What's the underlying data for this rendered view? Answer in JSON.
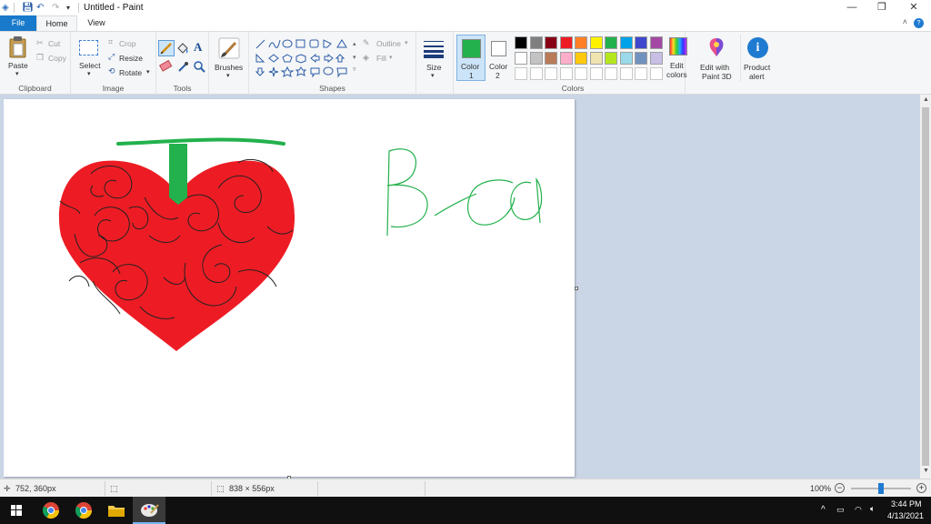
{
  "window": {
    "title": "Untitled - Paint",
    "minimize": "—",
    "restore": "❐",
    "close": "✕"
  },
  "tabs": {
    "file": "File",
    "home": "Home",
    "view": "View"
  },
  "ribbon": {
    "clipboard": {
      "label": "Clipboard",
      "paste": "Paste",
      "cut": "Cut",
      "copy": "Copy"
    },
    "image": {
      "label": "Image",
      "select": "Select",
      "crop": "Crop",
      "resize": "Resize",
      "rotate": "Rotate"
    },
    "tools": {
      "label": "Tools"
    },
    "brushes": {
      "label": "Brushes"
    },
    "shapes": {
      "label": "Shapes",
      "outline": "Outline",
      "fill": "Fill"
    },
    "size": {
      "label": "Size"
    },
    "colors": {
      "label": "Colors",
      "color1_label": "Color",
      "color1_num": "1",
      "color1_value": "#22b14c",
      "color2_label": "Color",
      "color2_num": "2",
      "color2_value": "#ffffff",
      "edit_colors_1": "Edit",
      "edit_colors_2": "colors",
      "palette_row1": [
        "#000000",
        "#7f7f7f",
        "#880015",
        "#ed1c24",
        "#ff7f27",
        "#fff200",
        "#22b14c",
        "#00a2e8",
        "#3f48cc",
        "#a349a4"
      ],
      "palette_row2": [
        "#ffffff",
        "#c3c3c3",
        "#b97a57",
        "#ffaec9",
        "#ffc90e",
        "#efe4b0",
        "#b5e61d",
        "#99d9ea",
        "#7092be",
        "#c8bfe7"
      ]
    },
    "paint3d": {
      "line1": "Edit with",
      "line2": "Paint 3D"
    },
    "product_alert": {
      "line1": "Product",
      "line2": "alert"
    }
  },
  "status": {
    "cursor_pos": "752, 360px",
    "canvas_size": "838 × 556px",
    "zoom": "100%",
    "zoom_level": 0.5
  },
  "taskbar": {
    "time": "3:44 PM",
    "date": "4/13/2021"
  }
}
